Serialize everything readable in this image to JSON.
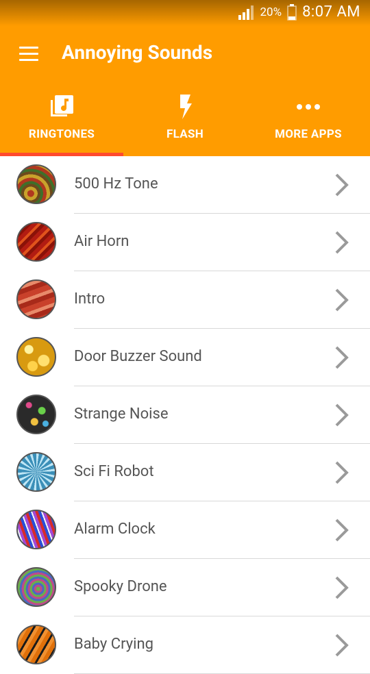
{
  "status_bar": {
    "battery": "20%",
    "time": "8:07 AM"
  },
  "app": {
    "title": "Annoying Sounds"
  },
  "tabs": [
    {
      "label": "RINGTONES",
      "icon": "music-library-icon",
      "selected": true
    },
    {
      "label": "FLASH",
      "icon": "flash-icon",
      "selected": false
    },
    {
      "label": "MORE APPS",
      "icon": "more-dots-icon",
      "selected": false
    }
  ],
  "sounds": [
    {
      "title": "500 Hz Tone",
      "icon": "avatar-500hz"
    },
    {
      "title": "Air Horn",
      "icon": "avatar-air-horn"
    },
    {
      "title": "Intro",
      "icon": "avatar-intro"
    },
    {
      "title": "Door Buzzer Sound",
      "icon": "avatar-door-buzzer"
    },
    {
      "title": "Strange Noise",
      "icon": "avatar-strange-noise"
    },
    {
      "title": "Sci Fi Robot",
      "icon": "avatar-sci-fi-robot"
    },
    {
      "title": "Alarm Clock",
      "icon": "avatar-alarm-clock"
    },
    {
      "title": "Spooky Drone",
      "icon": "avatar-spooky-drone"
    },
    {
      "title": "Baby Crying",
      "icon": "avatar-baby-crying"
    }
  ],
  "colors": {
    "primary": "#FF9C00",
    "indicator": "#FF4A2E",
    "text": "#555555",
    "divider": "#D8D8D8"
  }
}
